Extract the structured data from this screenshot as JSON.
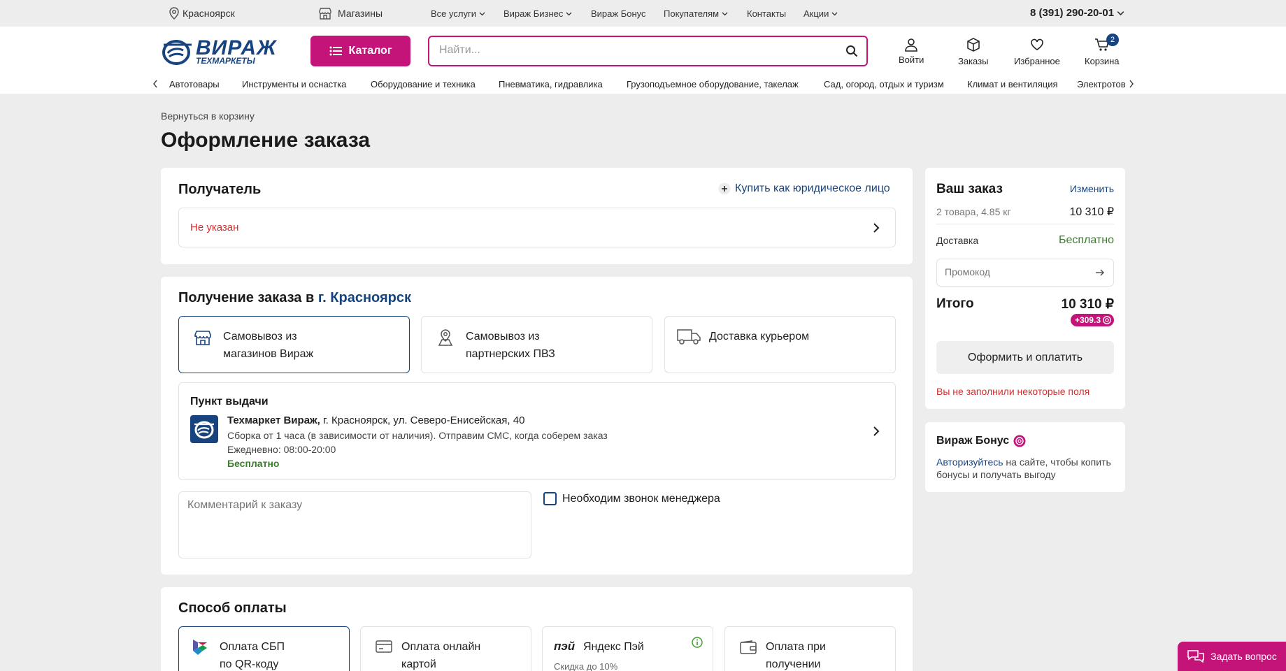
{
  "topbar": {
    "city": "Красноярск",
    "stores": "Магазины",
    "services": "Все услуги",
    "business": "Вираж Бизнес",
    "bonus": "Вираж Бонус",
    "customers": "Покупателям",
    "contacts": "Контакты",
    "promo": "Акции",
    "phone": "8 (391) 290-20-01"
  },
  "header": {
    "logo_main": "ВИРАЖ",
    "logo_sub": "ТЕХМАРКЕТЫ",
    "catalog": "Каталог",
    "search_placeholder": "Найти...",
    "login": "Войти",
    "orders": "Заказы",
    "favorites": "Избранное",
    "cart": "Корзина",
    "cart_count": "2"
  },
  "catnav": [
    "Автотовары",
    "Инструменты и оснастка",
    "Оборудование и техника",
    "Пневматика, гидравлика",
    "Грузоподъемное оборудование, такелаж",
    "Сад, огород, отдых и туризм",
    "Климат и вентиляция",
    "Электротовары"
  ],
  "page": {
    "back": "Вернуться в корзину",
    "title": "Оформление заказа"
  },
  "recipient": {
    "title": "Получатель",
    "legal": "Купить как юридическое лицо",
    "status": "Не указан"
  },
  "delivery": {
    "title_prefix": "Получение заказа в",
    "city": "г. Красноярск",
    "options": [
      {
        "line1": "Самовывоз из",
        "line2": "магазинов Вираж"
      },
      {
        "line1": "Самовывоз из",
        "line2": "партнерских ПВЗ"
      },
      {
        "line1": "Доставка курьером",
        "line2": ""
      }
    ],
    "point_title": "Пункт выдачи",
    "store_name": "Техмаркет Вираж,",
    "store_addr": " г. Красноярск, ул. Северо-Енисейская, 40",
    "assembly": "Сборка от 1 часа (в зависимости от наличия). Отправим СМС, когда соберем заказ",
    "hours": "Ежедневно: 08:00-20:00",
    "price": "Бесплатно",
    "comment_placeholder": "Комментарий к заказу",
    "call_manager": "Необходим звонок менеджера"
  },
  "payment": {
    "title": "Способ оплаты",
    "options": [
      {
        "line1": "Оплата СБП",
        "line2": "по QR-коду"
      },
      {
        "line1": "Оплата онлайн",
        "line2": "картой"
      },
      {
        "line1": "Яндекс Пэй",
        "line2": "Скидка до 10%"
      },
      {
        "line1": "Оплата при",
        "line2": "получении"
      }
    ],
    "yapay_logo": "пэй"
  },
  "summary": {
    "title": "Ваш заказ",
    "edit": "Изменить",
    "items": "2 товара, 4.85 кг",
    "items_price": "10 310 ₽",
    "delivery_label": "Доставка",
    "delivery_value": "Бесплатно",
    "promo_placeholder": "Промокод",
    "total_label": "Итого",
    "total_value": "10 310 ₽",
    "bonus": "+309.3",
    "checkout": "Оформить и оплатить",
    "error": "Вы не заполнили некоторые поля"
  },
  "bonus": {
    "title": "Вираж Бонус",
    "link": "Авторизуйтесь",
    "text": " на сайте, чтобы копить бонусы и получать выгоду"
  },
  "chat": {
    "label": "Задать вопрос"
  },
  "colors": {
    "brand": "#c4147a",
    "accent": "#17447f",
    "error": "#d32f2f",
    "success": "#3a7d2b"
  }
}
